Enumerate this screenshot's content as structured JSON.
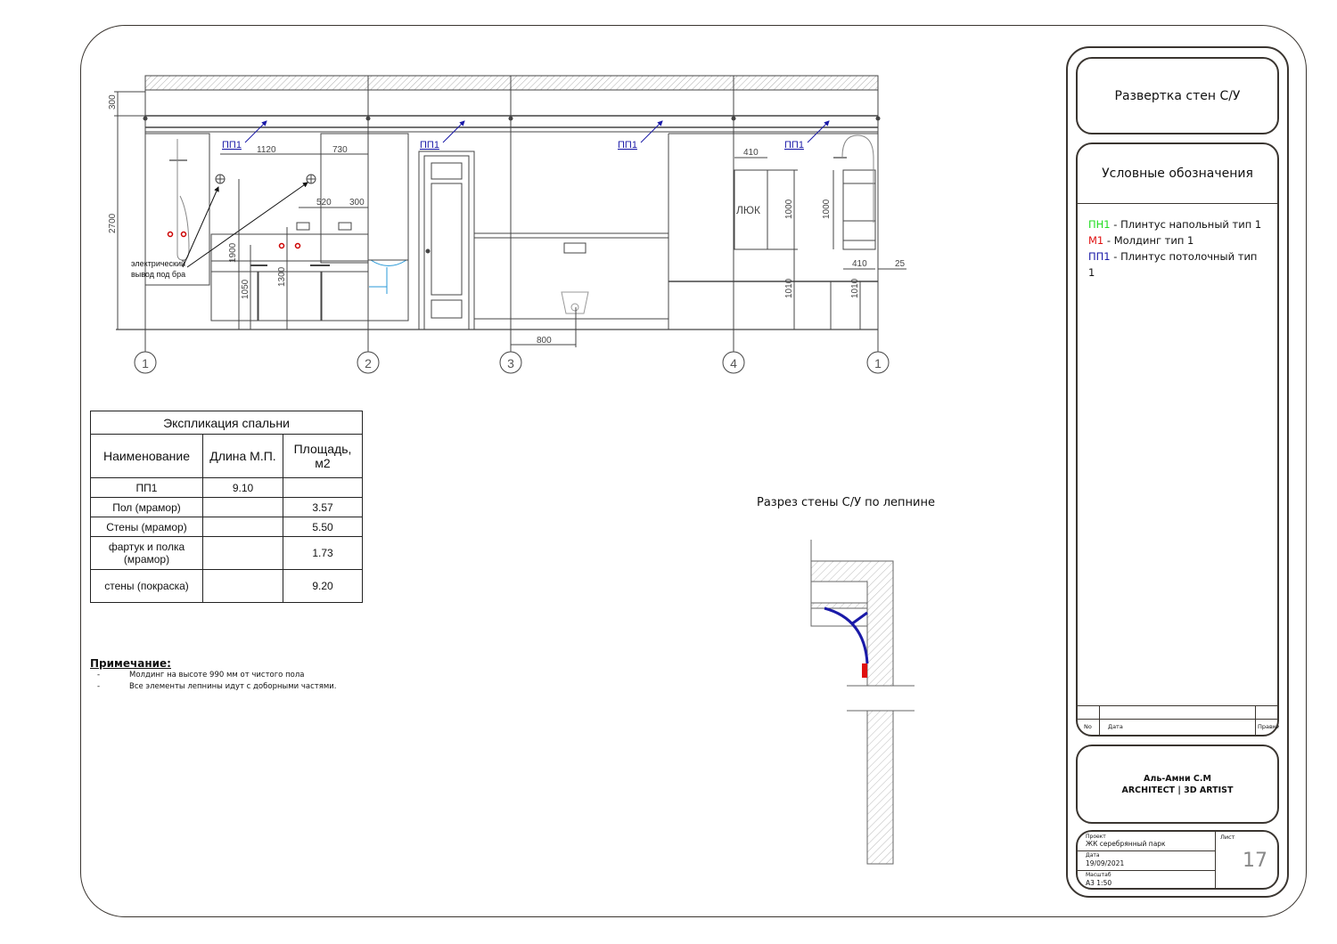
{
  "elevation": {
    "labels": {
      "pp1": "ПП1",
      "electric_note_1": "электрический",
      "electric_note_2": "вывод под бра",
      "hatch_label": "ЛЮК"
    },
    "dimensions": {
      "d300": "300",
      "d2700": "2700",
      "d1120": "1120",
      "d730": "730",
      "d520": "520",
      "d300b": "300",
      "d1900": "1900",
      "d1050": "1050",
      "d1300": "1300",
      "d800": "800",
      "d410a": "410",
      "d1000a": "1000",
      "d1000b": "1000",
      "d410b": "410",
      "d25": "25",
      "d1010a": "1010",
      "d1010b": "1010"
    },
    "axes": [
      "1",
      "2",
      "3",
      "4",
      "1"
    ]
  },
  "explication": {
    "title": "Экспликация спальни",
    "headers": [
      "Наименование",
      "Длина М.П.",
      "Площадь, м2"
    ],
    "rows": [
      {
        "name": "ПП1",
        "length": "9.10",
        "area": ""
      },
      {
        "name": "Пол (мрамор)",
        "length": "",
        "area": "3.57"
      },
      {
        "name": "Стены (мрамор)",
        "length": "",
        "area": "5.50"
      },
      {
        "name": "фартук и полка (мрамор)",
        "length": "",
        "area": "1.73"
      },
      {
        "name": "стены (покраска)",
        "length": "",
        "area": "9.20"
      }
    ]
  },
  "notes": {
    "title": "Примечание:",
    "items": [
      "Молдинг на высоте 990 мм от чистого пола",
      "Все элементы лепнины идут с доборными частями."
    ]
  },
  "section": {
    "title": "Разрез стены С/У по лепнине"
  },
  "title_block": {
    "sheet_title": "Развертка стен С/У",
    "legend_title": "Условные обозначения",
    "legend": [
      {
        "code": "ПН1",
        "text": " - Плинтус напольный тип 1",
        "color": "#22dd22"
      },
      {
        "code": "М1",
        "text": " - Молдинг тип 1",
        "color": "#e01010"
      },
      {
        "code": "ПП1",
        "text": " - Плинтус потолочный тип 1",
        "color": "#1a1aa8"
      }
    ],
    "revision": {
      "no": "No",
      "date": "Дата",
      "rev": "Правки"
    },
    "author_name": "Аль-Амни С.М",
    "author_role": "ARCHITECT | 3D ARTIST",
    "project_label": "Проект",
    "project": "ЖК серебрянный парк",
    "date_label": "Дата",
    "date": "19/09/2021",
    "scale_label": "Масштаб",
    "scale": "А3  1:50",
    "sheet_label": "Лист",
    "sheet": "17"
  },
  "colors": {
    "line": "#3a3530",
    "pp1": "#1a1aa8",
    "molding": "#e01010",
    "plumbing": "#2a9ad8"
  }
}
